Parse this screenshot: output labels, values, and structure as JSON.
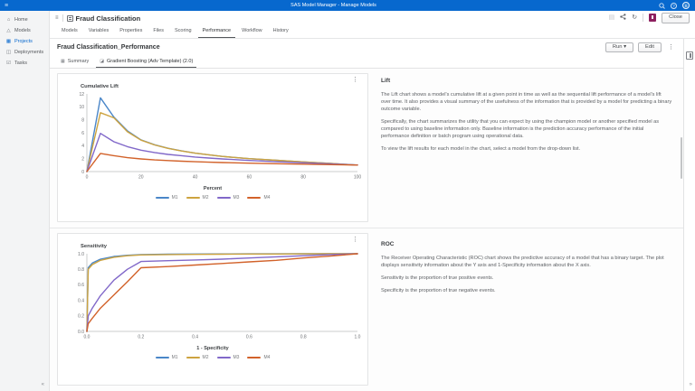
{
  "icons": {
    "hamburger": "≡",
    "home": "⌂",
    "models": "△",
    "projects": "▦",
    "deployments": "◫",
    "tasks": "☑",
    "list": "≡",
    "refresh": "↻",
    "disabled_doc": "▤",
    "kebab": "⋮",
    "summary_tab": "▦",
    "model_tab": "◪",
    "collapse_left": "«",
    "collapse_right": "»",
    "avatar_initial": "S",
    "help": "?"
  },
  "topbar": {
    "title": "SAS Model Manager - Manage Models",
    "color": "#0768ce"
  },
  "sidebar": {
    "items": [
      {
        "label": "Home"
      },
      {
        "label": "Models"
      },
      {
        "label": "Projects",
        "selected": true
      },
      {
        "label": "Deployments"
      },
      {
        "label": "Tasks"
      }
    ]
  },
  "header": {
    "title": "Fraud Classification",
    "close_label": "Close"
  },
  "tabs": [
    "Models",
    "Variables",
    "Properties",
    "Files",
    "Scoring",
    "Performance",
    "Workflow",
    "History"
  ],
  "active_tab": "Performance",
  "page": {
    "title": "Fraud Classification_Performance",
    "run_label": "Run ▾",
    "edit_label": "Edit"
  },
  "model_tabs": [
    {
      "label": "Summary"
    },
    {
      "label": "Gradient Boosting (Adv Template) (2.0)",
      "selected": true
    }
  ],
  "sections": [
    {
      "heading": "Lift",
      "paragraphs": [
        "The Lift chart shows a model's cumulative lift at a given point in time as well as the sequential lift performance of a model's lift over time. It also provides a visual summary of the usefulness of the information that is provided by a model for predicting a binary outcome variable.",
        "Specifically, the chart summarizes the utility that you can expect by using the champion model or another specified model as compared to using baseline information only. Baseline information is the prediction accuracy performance of the initial performance definition or batch program using operational data.",
        "To view the lift results for each model in the chart, select a model from the drop-down list."
      ]
    },
    {
      "heading": "ROC",
      "paragraphs": [
        "The Receiver Operating Characteristic (ROC) chart shows the predictive accuracy of a model that has a binary target. The plot displays sensitivity information about the Y axis and 1-Specificity information about the X axis.",
        "Sensitivity is the proportion of true positive events.",
        "Specificity is the proportion of true negative events."
      ]
    }
  ],
  "chart_data": [
    {
      "type": "line",
      "title": "Cumulative Lift",
      "xlabel": "Percent",
      "ylabel": "Cumulative Lift",
      "xlim": [
        0,
        100
      ],
      "ylim": [
        0,
        12
      ],
      "xticks": [
        {
          "v": 0,
          "label": "0"
        },
        {
          "v": 20,
          "label": "20"
        },
        {
          "v": 40,
          "label": "40"
        },
        {
          "v": 60,
          "label": "60"
        },
        {
          "v": 80,
          "label": "80"
        },
        {
          "v": 100,
          "label": "100"
        }
      ],
      "yticks": [
        {
          "v": 0,
          "label": "0"
        },
        {
          "v": 2,
          "label": "2"
        },
        {
          "v": 4,
          "label": "4"
        },
        {
          "v": 6,
          "label": "6"
        },
        {
          "v": 8,
          "label": "8"
        },
        {
          "v": 10,
          "label": "10"
        },
        {
          "v": 12,
          "label": "12"
        }
      ],
      "grid": false,
      "legend_position": "bottom",
      "x": [
        0,
        5,
        10,
        15,
        20,
        25,
        30,
        35,
        40,
        45,
        50,
        60,
        70,
        80,
        90,
        100
      ],
      "series": [
        {
          "name": "M1",
          "color": "#4a86c8",
          "values": [
            0,
            11.4,
            8.4,
            6.3,
            4.9,
            4.15,
            3.6,
            3.2,
            2.85,
            2.6,
            2.35,
            2.0,
            1.75,
            1.5,
            1.25,
            1.0
          ]
        },
        {
          "name": "M2",
          "color": "#cda33f",
          "values": [
            0,
            9.1,
            8.3,
            6.15,
            4.85,
            4.12,
            3.58,
            3.18,
            2.84,
            2.59,
            2.34,
            1.99,
            1.74,
            1.5,
            1.25,
            1.0
          ]
        },
        {
          "name": "M3",
          "color": "#8168c9",
          "values": [
            0,
            5.9,
            4.6,
            3.85,
            3.3,
            2.95,
            2.65,
            2.45,
            2.25,
            2.1,
            1.95,
            1.72,
            1.52,
            1.35,
            1.18,
            1.02
          ]
        },
        {
          "name": "M4",
          "color": "#d2622a",
          "values": [
            0,
            2.8,
            2.45,
            2.15,
            1.95,
            1.8,
            1.7,
            1.6,
            1.52,
            1.45,
            1.4,
            1.3,
            1.22,
            1.15,
            1.08,
            1.0
          ]
        }
      ]
    },
    {
      "type": "line",
      "title": "Sensitivity",
      "xlabel": "1 - Specificity",
      "ylabel": "Sensitivity",
      "xlim": [
        0,
        1
      ],
      "ylim": [
        0,
        1
      ],
      "xticks": [
        {
          "v": 0,
          "label": "0.0"
        },
        {
          "v": 0.2,
          "label": "0.2"
        },
        {
          "v": 0.4,
          "label": "0.4"
        },
        {
          "v": 0.6,
          "label": "0.6"
        },
        {
          "v": 0.8,
          "label": "0.8"
        },
        {
          "v": 1,
          "label": "1.0"
        }
      ],
      "yticks": [
        {
          "v": 0,
          "label": "0.0"
        },
        {
          "v": 0.2,
          "label": "0.2"
        },
        {
          "v": 0.4,
          "label": "0.4"
        },
        {
          "v": 0.6,
          "label": "0.6"
        },
        {
          "v": 0.8,
          "label": "0.8"
        },
        {
          "v": 1,
          "label": "1.0"
        }
      ],
      "grid": false,
      "legend_position": "bottom",
      "x": [
        0,
        0.005,
        0.02,
        0.05,
        0.1,
        0.15,
        0.2,
        0.3,
        0.4,
        0.5,
        0.6,
        0.7,
        0.8,
        0.9,
        1.0
      ],
      "series": [
        {
          "name": "M1",
          "color": "#4a86c8",
          "values": [
            0,
            0.82,
            0.88,
            0.93,
            0.965,
            0.98,
            0.99,
            0.995,
            0.997,
            0.998,
            0.999,
            0.999,
            1,
            1,
            1
          ]
        },
        {
          "name": "M2",
          "color": "#cda33f",
          "values": [
            0,
            0.8,
            0.86,
            0.915,
            0.955,
            0.975,
            0.985,
            0.99,
            0.992,
            0.994,
            0.996,
            0.997,
            0.999,
            1,
            1
          ]
        },
        {
          "name": "M3",
          "color": "#8168c9",
          "values": [
            0,
            0.2,
            0.3,
            0.46,
            0.66,
            0.8,
            0.9,
            0.91,
            0.92,
            0.93,
            0.945,
            0.96,
            0.975,
            0.99,
            1
          ]
        },
        {
          "name": "M4",
          "color": "#d2622a",
          "values": [
            0,
            0.1,
            0.17,
            0.3,
            0.47,
            0.64,
            0.82,
            0.835,
            0.855,
            0.875,
            0.895,
            0.915,
            0.945,
            0.97,
            1
          ]
        }
      ]
    }
  ]
}
